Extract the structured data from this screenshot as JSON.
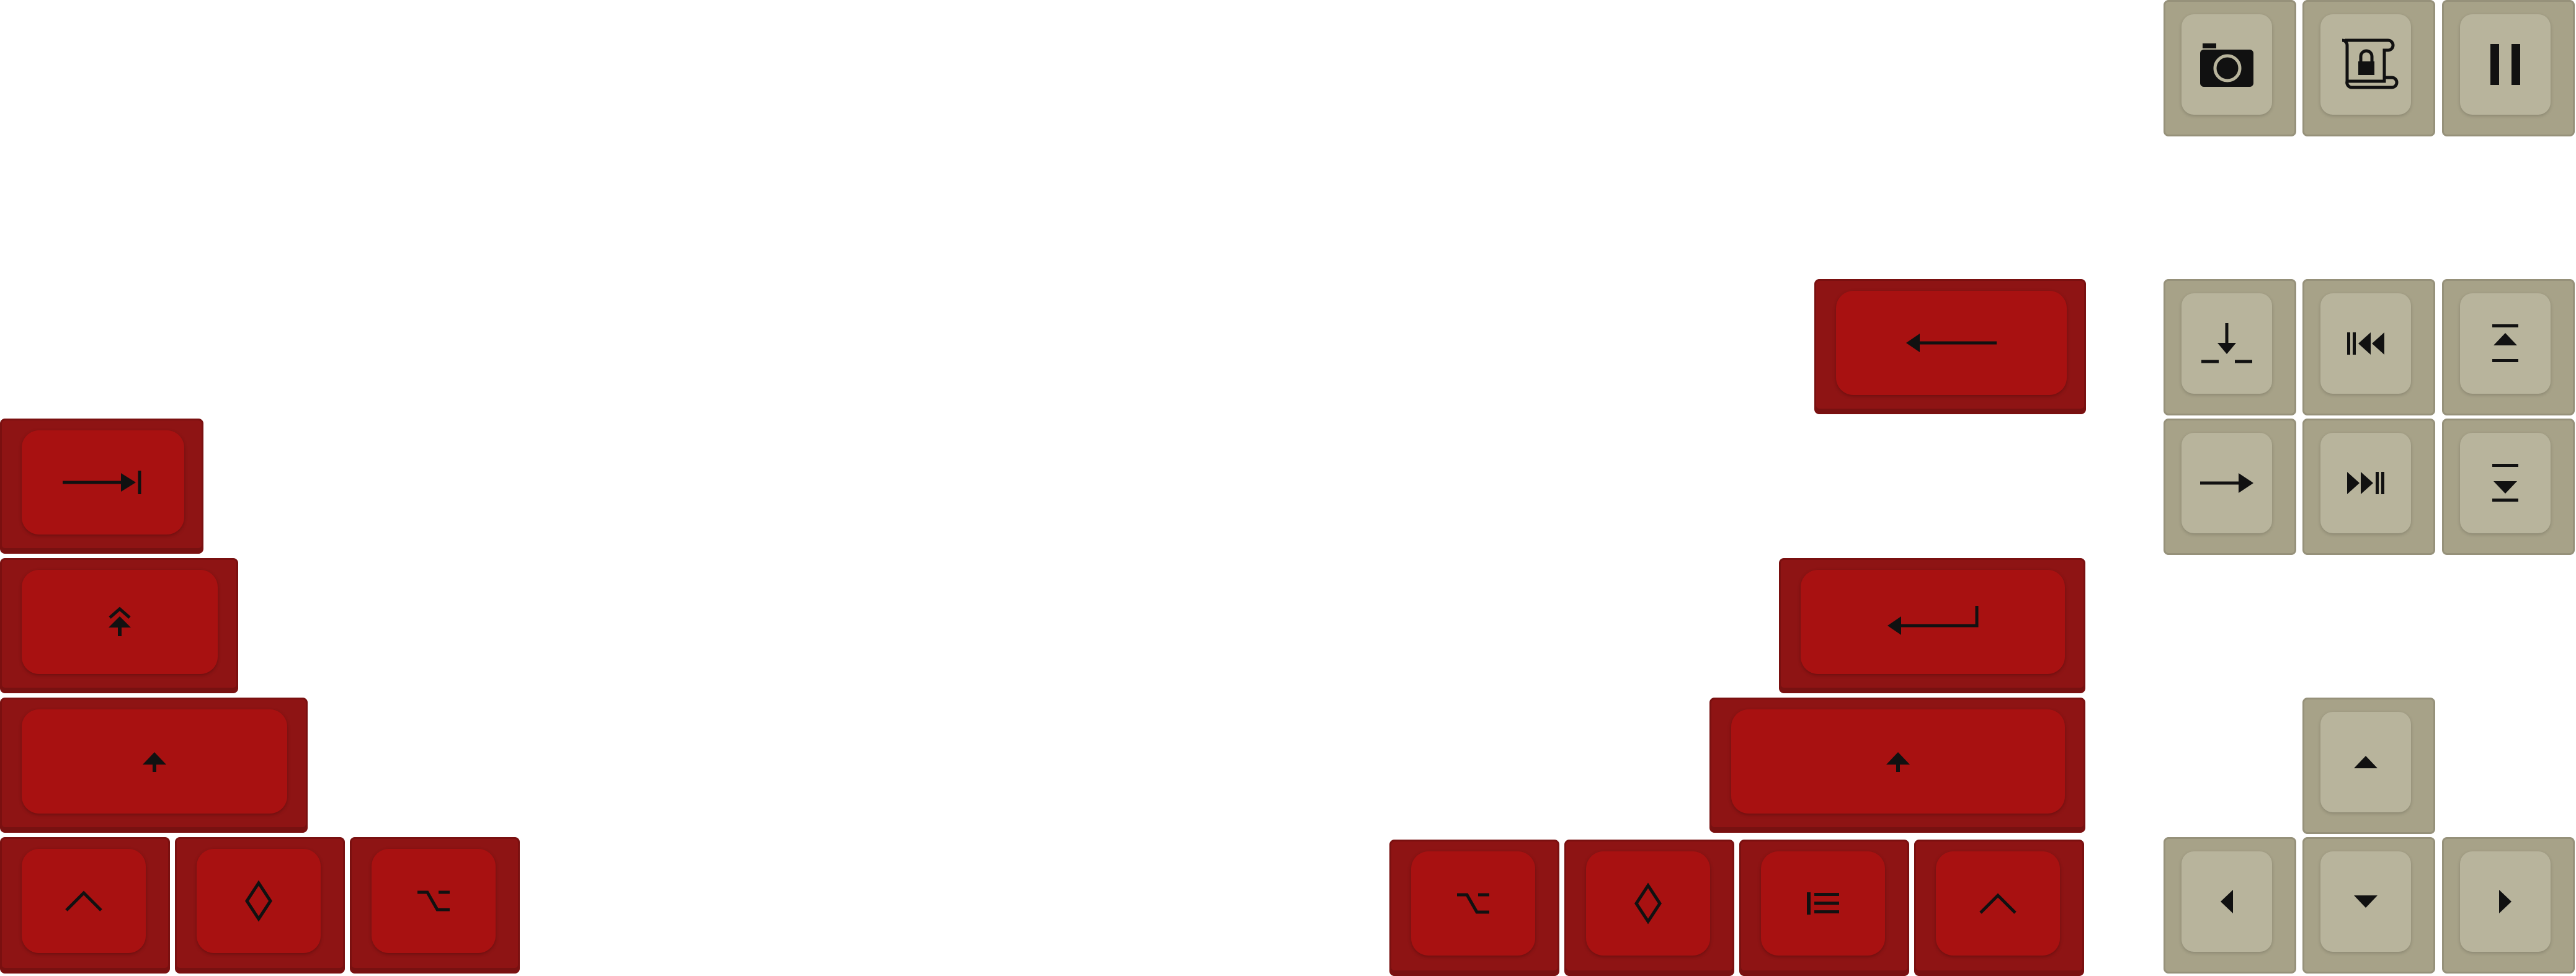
{
  "keyboard": {
    "colors": {
      "red_key": "#a81111",
      "red_key_side": "#8e1414",
      "beige_key": "#b8b49c",
      "beige_key_side": "#a7a288",
      "legend": "#111111"
    },
    "left_keys": [
      {
        "name": "tab-key",
        "icon": "tab-arrow-icon"
      },
      {
        "name": "caps-lock-key",
        "icon": "caps-lock-arrows-icon"
      },
      {
        "name": "left-shift-key",
        "icon": "shift-arrow-icon"
      },
      {
        "name": "left-control-key",
        "icon": "control-caret-icon"
      },
      {
        "name": "left-meta-key",
        "icon": "diamond-icon"
      },
      {
        "name": "left-alt-key",
        "icon": "option-icon"
      }
    ],
    "right_keys": [
      {
        "name": "backspace-key",
        "icon": "backspace-arrow-icon"
      },
      {
        "name": "enter-key",
        "icon": "enter-arrow-icon"
      },
      {
        "name": "right-shift-key",
        "icon": "shift-arrow-icon"
      },
      {
        "name": "right-alt-key",
        "icon": "option-icon"
      },
      {
        "name": "right-meta-key",
        "icon": "diamond-icon"
      },
      {
        "name": "menu-key",
        "icon": "menu-list-icon"
      },
      {
        "name": "right-control-key",
        "icon": "control-caret-icon"
      }
    ],
    "nav_keys": [
      {
        "name": "print-screen-key",
        "icon": "camera-icon"
      },
      {
        "name": "scroll-lock-key",
        "icon": "scroll-lock-icon"
      },
      {
        "name": "pause-key",
        "icon": "pause-icon"
      },
      {
        "name": "insert-key",
        "icon": "insert-icon"
      },
      {
        "name": "home-key",
        "icon": "home-skip-back-icon"
      },
      {
        "name": "page-up-key",
        "icon": "page-up-icon"
      },
      {
        "name": "delete-key",
        "icon": "delete-arrow-icon"
      },
      {
        "name": "end-key",
        "icon": "end-skip-forward-icon"
      },
      {
        "name": "page-down-key",
        "icon": "page-down-icon"
      },
      {
        "name": "arrow-up-key",
        "icon": "arrow-up-icon"
      },
      {
        "name": "arrow-left-key",
        "icon": "arrow-left-icon"
      },
      {
        "name": "arrow-down-key",
        "icon": "arrow-down-icon"
      },
      {
        "name": "arrow-right-key",
        "icon": "arrow-right-icon"
      }
    ]
  }
}
